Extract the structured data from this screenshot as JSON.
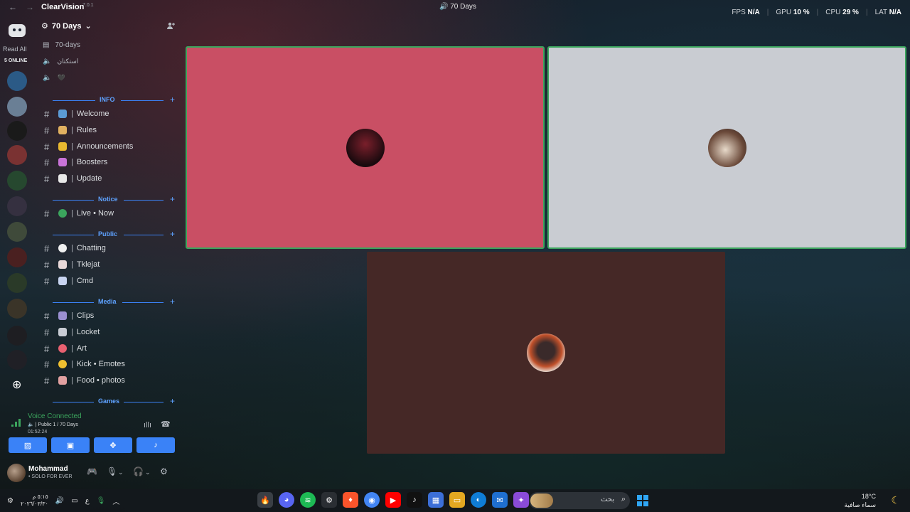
{
  "titlebar": {
    "back": "←",
    "forward": "→",
    "app_name": "ClearVision",
    "app_version": "7.0.1",
    "window_title": "70 Days",
    "stats": [
      {
        "label": "FPS",
        "value": "N/A"
      },
      {
        "label": "GPU",
        "value": "10 %"
      },
      {
        "label": "CPU",
        "value": "29 %"
      },
      {
        "label": "LAT",
        "value": "N/A"
      }
    ]
  },
  "rail": {
    "read_all": "Read All",
    "online": "5 ONLINE"
  },
  "server": {
    "name": "70 Days",
    "voice_channels": [
      {
        "label": "70-days"
      },
      {
        "label": "استكتان"
      },
      {
        "label": "🖤"
      }
    ]
  },
  "categories": [
    {
      "label": "INFO",
      "channels": [
        "Welcome",
        "Rules",
        "Announcements",
        "Boosters",
        "Update"
      ]
    },
    {
      "label": "Notice",
      "channels": [
        "Live • Now"
      ]
    },
    {
      "label": "Public",
      "channels": [
        "Chatting",
        "Tklejat",
        "Cmd"
      ]
    },
    {
      "label": "Media",
      "channels": [
        "Clips",
        "Locket",
        "Art",
        "Kick • Emotes",
        "Food • photos"
      ]
    },
    {
      "label": "Games",
      "channels": []
    }
  ],
  "voice": {
    "status": "Voice Connected",
    "channel": "| Public 1 / 70 Days",
    "elapsed": "01:52:24"
  },
  "user": {
    "name": "Mohammad",
    "status": "• SOLO FOR EVER"
  },
  "tiles": [
    {
      "color": "#c94f64",
      "speaking": true
    },
    {
      "color": "#c9ccd2",
      "speaking": true
    },
    {
      "color": "#452826",
      "speaking": false
    }
  ],
  "taskbar": {
    "clock_line1": "٥:١٥ م",
    "clock_line2": "٢٠٢٦/٠٣/٣٠",
    "lang": "ع",
    "search_placeholder": "بحث",
    "weather_temp": "18°C",
    "weather_desc": "سماء صافية"
  },
  "colors": {
    "accent_blue": "#3a82f7",
    "category_blue": "#5ea2ff",
    "voice_green": "#3ba55d"
  }
}
